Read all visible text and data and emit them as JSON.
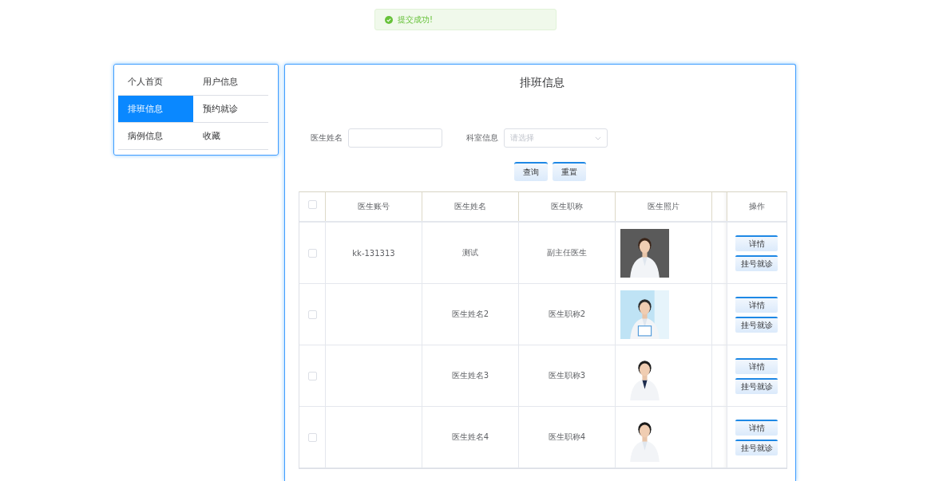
{
  "toast": {
    "text": "提交成功!",
    "kind": "success"
  },
  "nav": {
    "items": [
      {
        "label": "个人首页",
        "selected": false
      },
      {
        "label": "用户信息",
        "selected": false
      },
      {
        "label": "排班信息",
        "selected": true
      },
      {
        "label": "预约就诊",
        "selected": false
      },
      {
        "label": "病例信息",
        "selected": false
      },
      {
        "label": "收藏",
        "selected": false
      }
    ]
  },
  "panel": {
    "title": "排班信息",
    "filters": [
      {
        "kind": "input",
        "label": "医生姓名"
      },
      {
        "kind": "select",
        "label": "科室信息",
        "placeholder": "请选择"
      }
    ],
    "buttons": [
      "查询",
      "重置"
    ],
    "table": {
      "select_all": {
        "checked": false
      },
      "columns": [
        "医生账号",
        "医生姓名",
        "医生职称",
        "医生照片",
        "操作"
      ],
      "rows": [
        {
          "checked": false,
          "account": "kk-131313",
          "name": "测试",
          "title": "副主任医生",
          "actions": [
            "详情",
            "挂号就诊"
          ]
        },
        {
          "checked": false,
          "name": "医生姓名2",
          "title": "医生职称2",
          "actions": [
            "详情",
            "挂号就诊"
          ]
        },
        {
          "checked": false,
          "name": "医生姓名3",
          "title": "医生职称3",
          "actions": [
            "详情",
            "挂号就诊"
          ]
        },
        {
          "checked": false,
          "name": "医生姓名4",
          "title": "医生职称4",
          "actions": [
            "详情",
            "挂号就诊"
          ]
        }
      ]
    }
  }
}
